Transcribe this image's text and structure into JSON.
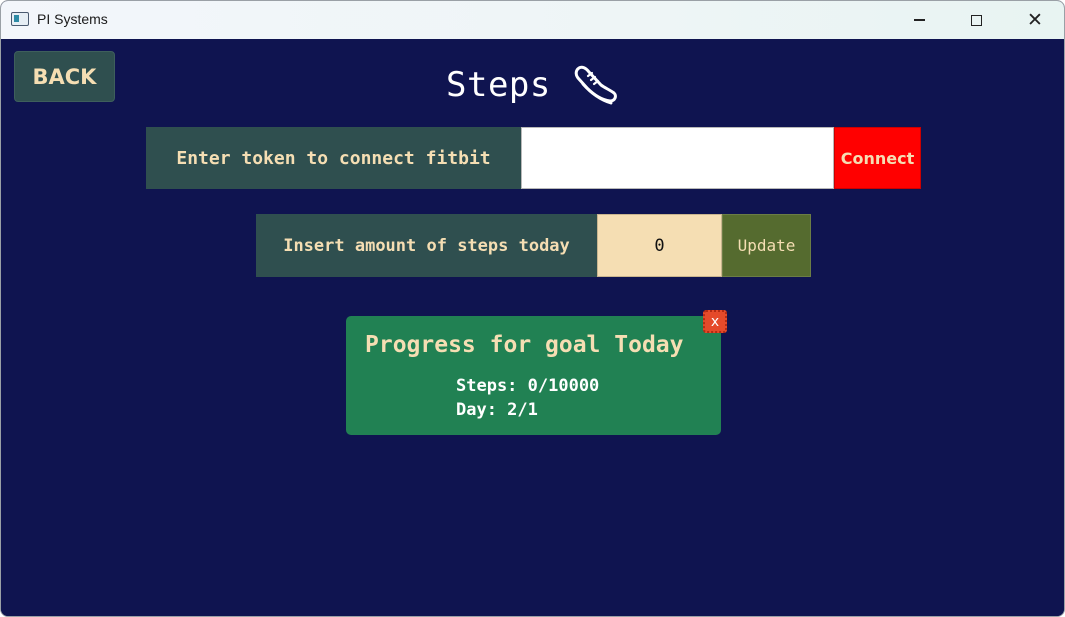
{
  "window": {
    "title": "PI Systems",
    "icon": "app-window-icon",
    "controls": {
      "minimize": "minimize-icon",
      "maximize": "maximize-icon",
      "close": "close-icon"
    }
  },
  "nav": {
    "back_label": "BACK"
  },
  "header": {
    "title": "Steps",
    "icon": "sneaker-icon"
  },
  "fitbit": {
    "label": "Enter token to connect fitbit",
    "token_value": "",
    "connect_label": "Connect"
  },
  "steps_entry": {
    "label": "Insert amount of steps today",
    "value": "0",
    "update_label": "Update"
  },
  "progress": {
    "title": "Progress for goal Today",
    "steps_line": "Steps: 0/10000",
    "day_line": "Day: 2/1",
    "close_label": "x"
  },
  "colors": {
    "background": "#0f1450",
    "panel": "#2f4f4f",
    "text_accent": "#f5deb3",
    "connect": "#ff0000",
    "update": "#556b2f",
    "card": "#218153",
    "card_close": "#e54a2a"
  }
}
